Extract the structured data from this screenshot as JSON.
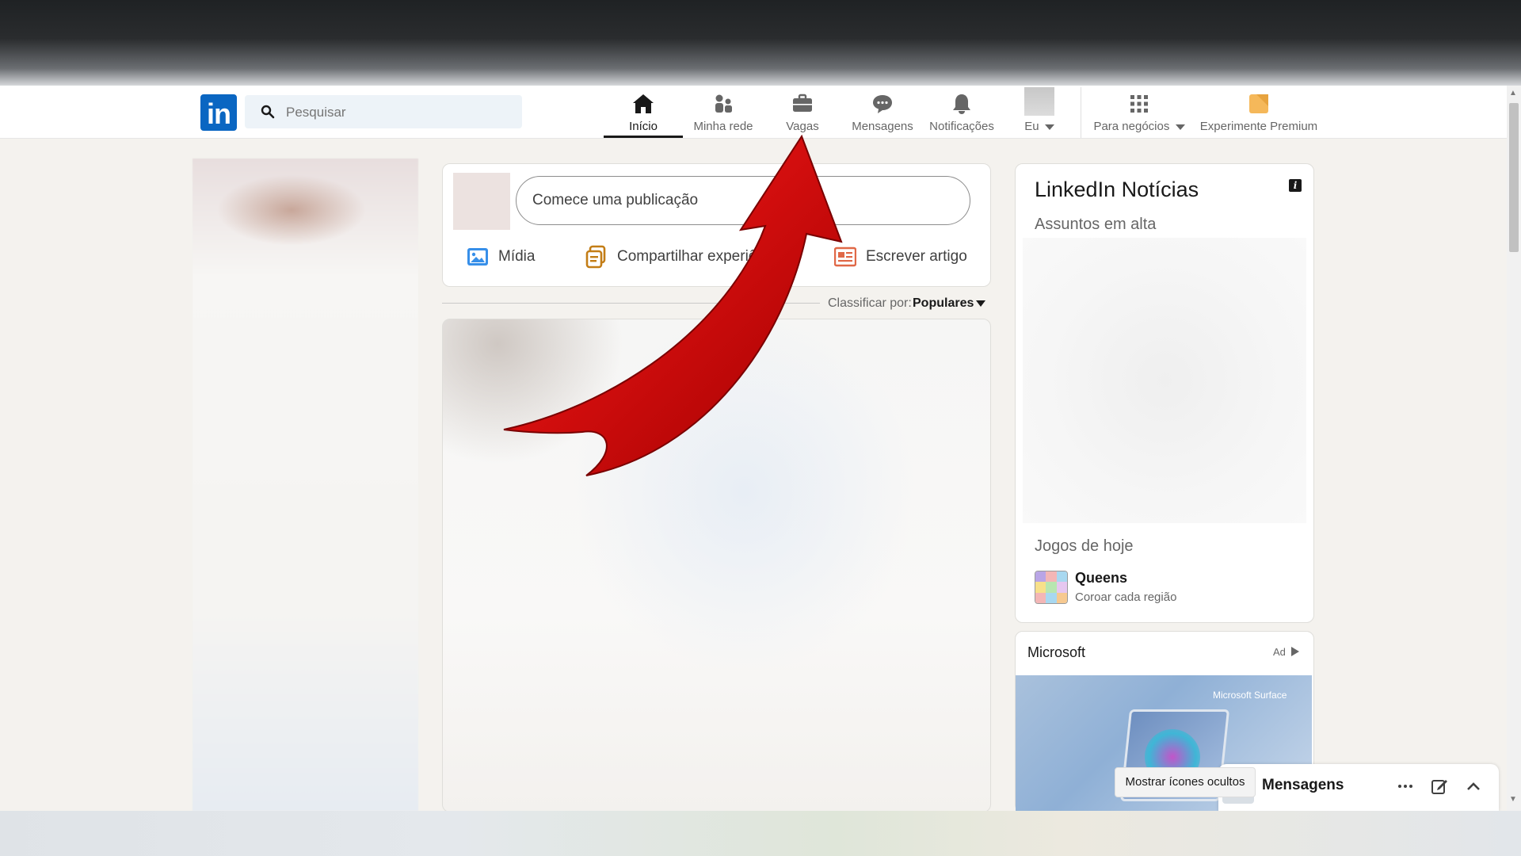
{
  "colors": {
    "brand": "#0a66c2",
    "accent_arrow": "#d50000",
    "background": "#f4f2ee"
  },
  "header": {
    "logo_text": "in",
    "search": {
      "placeholder": "Pesquisar",
      "value": ""
    },
    "nav": [
      {
        "label": "Início",
        "icon": "home-icon",
        "active": true
      },
      {
        "label": "Minha rede",
        "icon": "network-icon"
      },
      {
        "label": "Vagas",
        "icon": "briefcase-icon"
      },
      {
        "label": "Mensagens",
        "icon": "messaging-icon"
      },
      {
        "label": "Notificações",
        "icon": "bell-icon"
      },
      {
        "label": "Eu",
        "icon": "avatar"
      },
      {
        "label": "Para negócios",
        "icon": "grid-icon"
      },
      {
        "label": "Experimente Premium",
        "icon": "premium-icon"
      }
    ]
  },
  "composer": {
    "placeholder": "Comece uma publicação",
    "actions": [
      {
        "label": "Mídia",
        "icon": "media-icon"
      },
      {
        "label": "Compartilhar experiênci",
        "icon": "share-experience-icon"
      },
      {
        "label": "Escrever artigo",
        "icon": "article-icon"
      }
    ]
  },
  "sort": {
    "label": "Classificar por:",
    "value": "Populares"
  },
  "news": {
    "title": "LinkedIn Notícias",
    "subtitle": "Assuntos em alta",
    "games_title": "Jogos de hoje",
    "game": {
      "name": "Queens",
      "desc": "Coroar cada região"
    }
  },
  "ad": {
    "title": "Microsoft",
    "label": "Ad",
    "brand": "Microsoft Surface"
  },
  "messaging": {
    "tooltip": "Mostrar ícones ocultos",
    "label": "Mensagens"
  }
}
